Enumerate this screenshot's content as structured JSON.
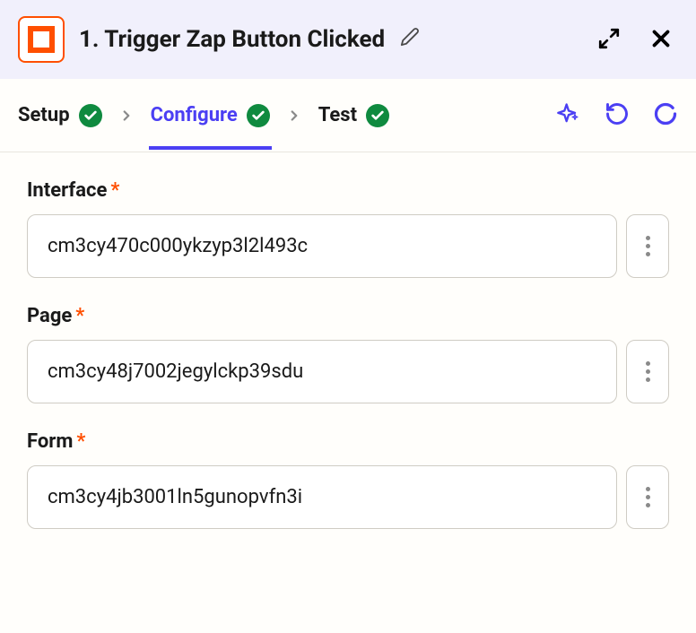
{
  "header": {
    "title": "1. Trigger Zap Button Clicked"
  },
  "tabs": {
    "setup": "Setup",
    "configure": "Configure",
    "test": "Test"
  },
  "fields": {
    "interface": {
      "label": "Interface",
      "value": "cm3cy470c000ykzyp3l2l493c"
    },
    "page": {
      "label": "Page",
      "value": "cm3cy48j7002jegylckp39sdu"
    },
    "form": {
      "label": "Form",
      "value": "cm3cy4jb3001ln5gunopvfn3i"
    }
  }
}
